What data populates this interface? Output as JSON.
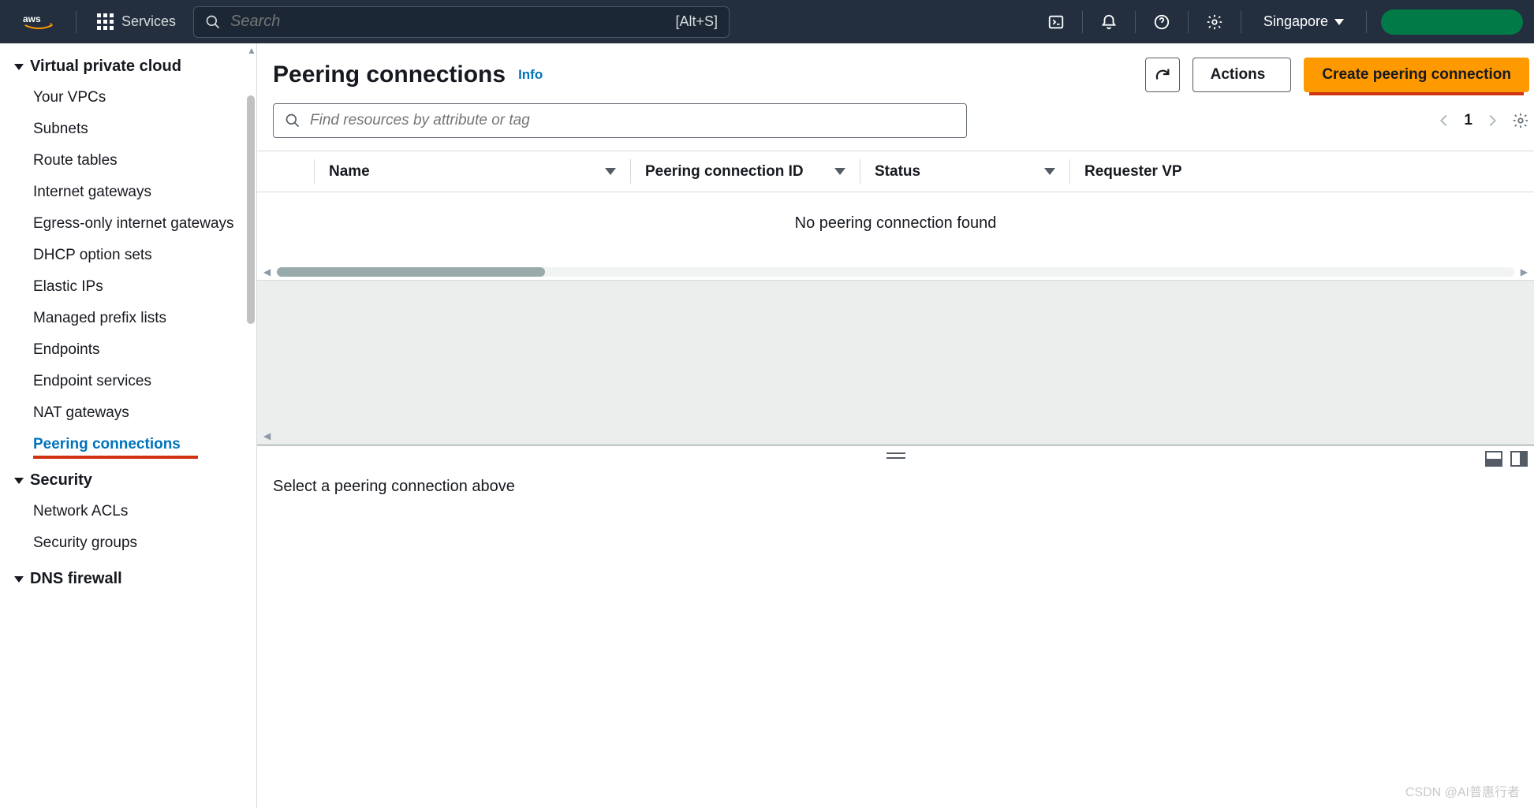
{
  "topnav": {
    "services_label": "Services",
    "search_placeholder": "Search",
    "search_hint": "[Alt+S]",
    "region": "Singapore"
  },
  "sidebar": {
    "sections": [
      {
        "title": "Virtual private cloud",
        "items": [
          "Your VPCs",
          "Subnets",
          "Route tables",
          "Internet gateways",
          "Egress-only internet gateways",
          "DHCP option sets",
          "Elastic IPs",
          "Managed prefix lists",
          "Endpoints",
          "Endpoint services",
          "NAT gateways",
          "Peering connections"
        ],
        "active": "Peering connections"
      },
      {
        "title": "Security",
        "items": [
          "Network ACLs",
          "Security groups"
        ]
      },
      {
        "title": "DNS firewall",
        "items": []
      }
    ]
  },
  "page": {
    "title": "Peering connections",
    "info": "Info",
    "actions_label": "Actions",
    "create_label": "Create peering connection",
    "filter_placeholder": "Find resources by attribute or tag",
    "page_number": "1",
    "columns": [
      "Name",
      "Peering connection ID",
      "Status",
      "Requester VP"
    ],
    "empty": "No peering connection found",
    "details_empty": "Select a peering connection above"
  },
  "watermark": "CSDN @AI普惠行者"
}
